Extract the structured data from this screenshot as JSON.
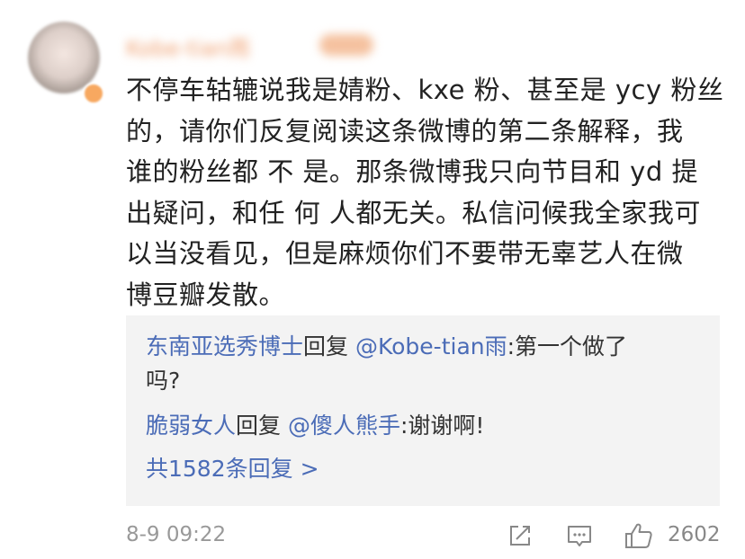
{
  "comment": {
    "username": "Kobe-tian雨",
    "body_lines": [
      "不停车轱辘说我是婧粉、kxe 粉、甚至是 ycy 粉丝",
      "的，请你们反复阅读这条微博的第二条解释，我",
      "谁的粉丝都 不 是。那条微博我只向节目和 yd 提",
      "出疑问，和任 何 人都无关。私信问候我全家我可",
      "以当没看见，但是麻烦你们不要带无辜艺人在微",
      "博豆瓣发散。"
    ],
    "replies": [
      {
        "name": "东南亚选秀博士",
        "action": "回复",
        "mention": "@Kobe-tian雨",
        "text_line1": ":第一个做了",
        "text_line2": "吗?"
      },
      {
        "name": "脆弱女人",
        "action": "回复",
        "mention": "@傻人熊手",
        "text_line1": ":谢谢啊!"
      }
    ],
    "more_replies_label": "共1582条回复 >",
    "timestamp": "8-9 09:22",
    "like_count": "2602"
  },
  "icons": {
    "share": "share-icon",
    "comment": "comment-icon",
    "like": "thumbs-up-icon"
  },
  "colors": {
    "link": "#4b6cb7",
    "text": "#222222",
    "muted": "#999999",
    "reply_bg": "#f3f3f3"
  }
}
